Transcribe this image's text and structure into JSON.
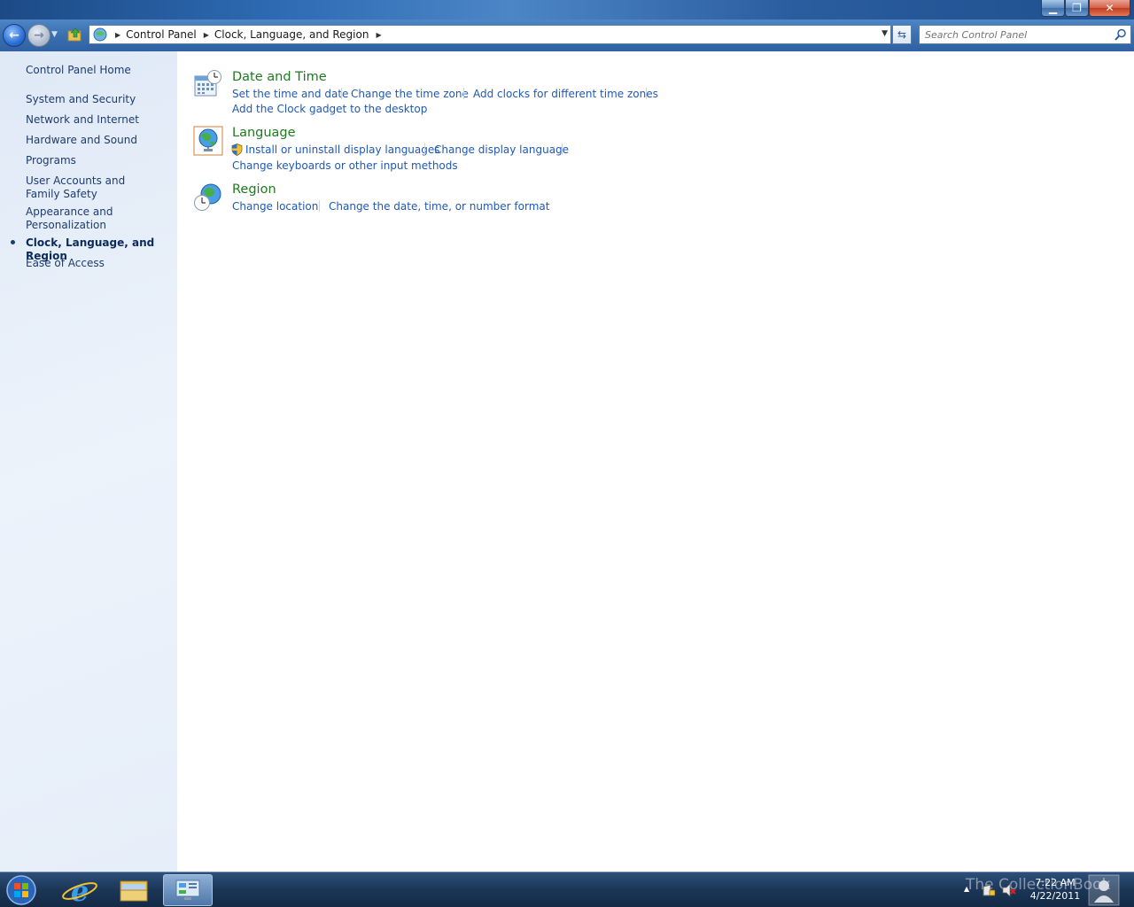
{
  "window": {
    "minimize_label": "▁",
    "maximize_label": "❐",
    "close_label": "✕"
  },
  "navbar": {
    "breadcrumbs": [
      "Control Panel",
      "Clock, Language, and Region"
    ],
    "search_placeholder": "Search Control Panel"
  },
  "sidebar": {
    "items": [
      {
        "label": "Control Panel Home"
      },
      {
        "label": "System and Security"
      },
      {
        "label": "Network and Internet"
      },
      {
        "label": "Hardware and Sound"
      },
      {
        "label": "Programs"
      },
      {
        "label": "User Accounts and Family Safety"
      },
      {
        "label": "Appearance and Personalization"
      },
      {
        "label": "Clock, Language, and Region",
        "current": true
      },
      {
        "label": "Ease of Access"
      }
    ]
  },
  "categories": [
    {
      "title": "Date and Time",
      "icon": "calendar-clock-icon",
      "tasks": [
        "Set the time and date",
        "Change the time zone",
        "Add clocks for different time zones",
        "Add the Clock gadget to the desktop"
      ]
    },
    {
      "title": "Language",
      "icon": "globe-icon",
      "tasks": [
        "Install or uninstall display languages",
        "Change display language",
        "Change keyboards or other input methods"
      ]
    },
    {
      "title": "Region",
      "icon": "globe-clock-icon",
      "tasks": [
        "Change location",
        "Change the date, time, or number format"
      ]
    }
  ],
  "taskbar": {
    "time": "7:22 AM",
    "date": "4/22/2011",
    "watermark": "The CollectionBook"
  },
  "colors": {
    "link": "#1f59b5",
    "category_title": "#1e7a1e",
    "sidebar_link": "#1e3c6e"
  }
}
